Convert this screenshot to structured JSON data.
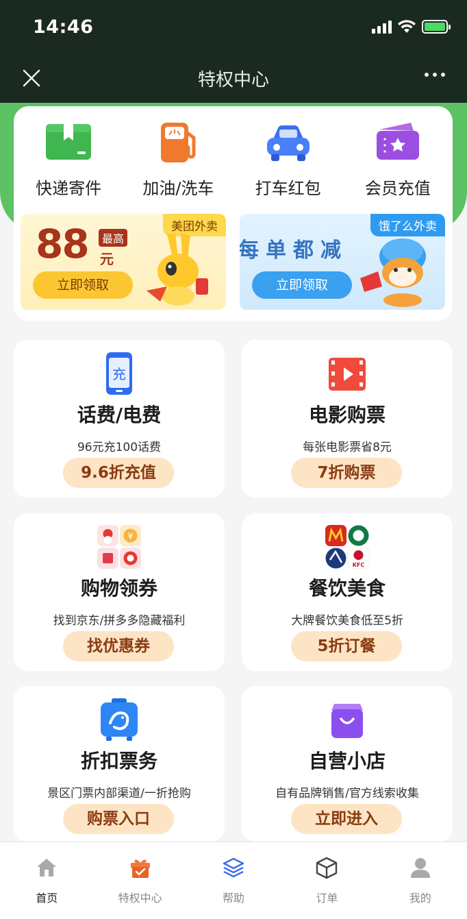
{
  "status_bar": {
    "time": "14:46"
  },
  "nav": {
    "title": "特权中心"
  },
  "quick_services": [
    {
      "label": "快递寄件",
      "icon": "package-icon"
    },
    {
      "label": "加油/洗车",
      "icon": "fuel-pump-icon"
    },
    {
      "label": "打车红包",
      "icon": "car-icon"
    },
    {
      "label": "会员充值",
      "icon": "member-ticket-icon"
    }
  ],
  "promos": {
    "meituan": {
      "tag": "美团外卖",
      "amount": "88",
      "max_label": "最高",
      "unit": "元",
      "button": "立即领取"
    },
    "eleme": {
      "tag": "饿了么外卖",
      "slogan": "每单都减",
      "button": "立即领取"
    }
  },
  "cards": [
    {
      "title": "话费/电费",
      "desc": "96元充100话费",
      "button": "9.6折充值",
      "icon": "phone-charge-icon"
    },
    {
      "title": "电影购票",
      "desc": "每张电影票省8元",
      "button": "7折购票",
      "icon": "film-icon"
    },
    {
      "title": "购物领券",
      "desc": "找到京东/拼多多隐藏福利",
      "button": "找优惠券",
      "icon": "shopping-apps-icon"
    },
    {
      "title": "餐饮美食",
      "desc": "大牌餐饮美食低至5折",
      "button": "5折订餐",
      "icon": "restaurant-brands-icon"
    },
    {
      "title": "折扣票务",
      "desc": "景区门票内部渠道/一折抢购",
      "button": "购票入口",
      "icon": "travel-ticket-icon"
    },
    {
      "title": "自营小店",
      "desc": "自有品牌销售/官方线索收集",
      "button": "立即进入",
      "icon": "shopping-bag-icon"
    }
  ],
  "tabbar": [
    {
      "label": "首页",
      "icon": "home-icon",
      "active": true
    },
    {
      "label": "特权中心",
      "icon": "gift-icon",
      "active": false
    },
    {
      "label": "帮助",
      "icon": "layers-icon",
      "active": false
    },
    {
      "label": "订单",
      "icon": "box-icon",
      "active": false
    },
    {
      "label": "我的",
      "icon": "user-icon",
      "active": false
    }
  ]
}
